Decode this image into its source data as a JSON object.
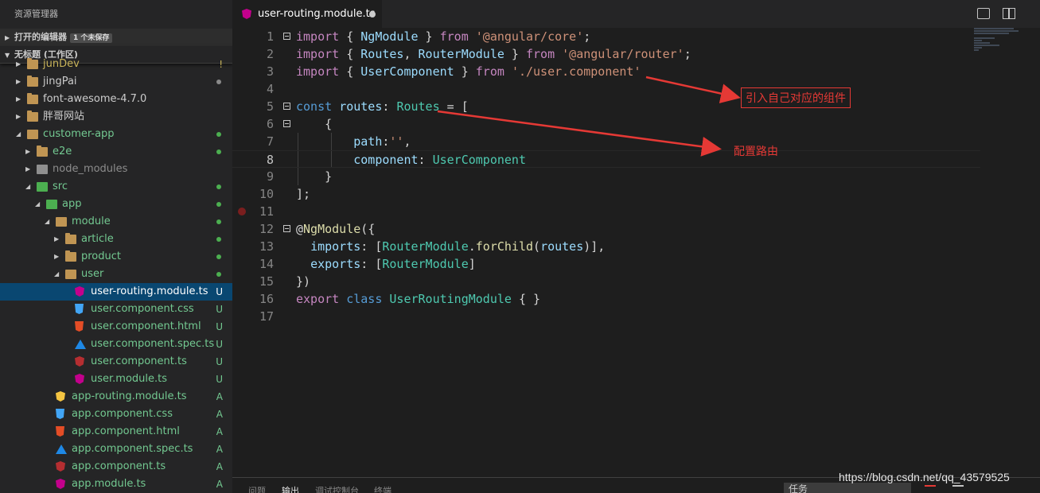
{
  "sidebar": {
    "title": "资源管理器",
    "open_editors": {
      "label": "打开的编辑器",
      "badge": "1 个未保存"
    },
    "workspace": {
      "label": "无标题 (工作区)"
    },
    "tree": [
      {
        "label": "junDev",
        "icon": "folder",
        "depth": 0,
        "color": "#c9b45a",
        "status": "!",
        "status_color": "#c9b45a"
      },
      {
        "label": "jingPai",
        "icon": "folder",
        "depth": 0,
        "color": "#cccccc",
        "dot": "#8a8a8a"
      },
      {
        "label": "font-awesome-4.7.0",
        "icon": "folder",
        "depth": 0,
        "color": "#cccccc"
      },
      {
        "label": "胖哥网站",
        "icon": "folder",
        "depth": 0,
        "color": "#cccccc"
      },
      {
        "label": "customer-app",
        "icon": "folder-open",
        "depth": 0,
        "color": "#73c991",
        "dot": "#4caf50",
        "open": true
      },
      {
        "label": "e2e",
        "icon": "folder",
        "depth": 1,
        "color": "#73c991",
        "dot": "#4caf50"
      },
      {
        "label": "node_modules",
        "icon": "folder-gray",
        "depth": 1,
        "color": "#8c8c8c"
      },
      {
        "label": "src",
        "icon": "folder-green",
        "depth": 1,
        "color": "#73c991",
        "dot": "#4caf50",
        "open": true
      },
      {
        "label": "app",
        "icon": "folder-green",
        "depth": 2,
        "color": "#73c991",
        "dot": "#4caf50",
        "open": true
      },
      {
        "label": "module",
        "icon": "folder-open",
        "depth": 3,
        "color": "#73c991",
        "dot": "#4caf50",
        "open": true
      },
      {
        "label": "article",
        "icon": "folder",
        "depth": 4,
        "color": "#73c991",
        "dot": "#4caf50"
      },
      {
        "label": "product",
        "icon": "folder",
        "depth": 4,
        "color": "#73c991",
        "dot": "#4caf50"
      },
      {
        "label": "user",
        "icon": "folder-open",
        "depth": 4,
        "color": "#73c991",
        "dot": "#4caf50",
        "open": true
      },
      {
        "label": "user-routing.module.ts",
        "icon": "ngp",
        "depth": 5,
        "color": "#ffffff",
        "status": "U",
        "status_color": "#ffffff",
        "selected": true
      },
      {
        "label": "user.component.css",
        "icon": "css",
        "depth": 5,
        "color": "#73c991",
        "status": "U",
        "status_color": "#73c991"
      },
      {
        "label": "user.component.html",
        "icon": "html",
        "depth": 5,
        "color": "#73c991",
        "status": "U",
        "status_color": "#73c991"
      },
      {
        "label": "user.component.spec.ts",
        "icon": "spec",
        "depth": 5,
        "color": "#73c991",
        "status": "U",
        "status_color": "#73c991"
      },
      {
        "label": "user.component.ts",
        "icon": "ng",
        "depth": 5,
        "color": "#73c991",
        "status": "U",
        "status_color": "#73c991"
      },
      {
        "label": "user.module.ts",
        "icon": "ngp",
        "depth": 5,
        "color": "#73c991",
        "status": "U",
        "status_color": "#73c991"
      },
      {
        "label": "app-routing.module.ts",
        "icon": "ngy",
        "depth": 3,
        "color": "#73c991",
        "status": "A",
        "status_color": "#73c991"
      },
      {
        "label": "app.component.css",
        "icon": "css",
        "depth": 3,
        "color": "#73c991",
        "status": "A",
        "status_color": "#73c991"
      },
      {
        "label": "app.component.html",
        "icon": "html",
        "depth": 3,
        "color": "#73c991",
        "status": "A",
        "status_color": "#73c991"
      },
      {
        "label": "app.component.spec.ts",
        "icon": "spec",
        "depth": 3,
        "color": "#73c991",
        "status": "A",
        "status_color": "#73c991"
      },
      {
        "label": "app.component.ts",
        "icon": "ng",
        "depth": 3,
        "color": "#73c991",
        "status": "A",
        "status_color": "#73c991"
      },
      {
        "label": "app.module.ts",
        "icon": "ngp",
        "depth": 3,
        "color": "#73c991",
        "status": "A",
        "status_color": "#73c991"
      }
    ]
  },
  "tab": {
    "name": "user-routing.module.ts",
    "icon": "angular-icon",
    "modified": true
  },
  "editor": {
    "current_line": 8,
    "breakpoint_line": 11,
    "lines": [
      {
        "n": "1",
        "fold": true,
        "tokens": [
          [
            "kc",
            "import"
          ],
          [
            "p",
            " { "
          ],
          [
            "v",
            "NgModule"
          ],
          [
            "p",
            " } "
          ],
          [
            "kc",
            "from"
          ],
          [
            "p",
            " "
          ],
          [
            "s",
            "'@angular/core'"
          ],
          [
            "p",
            ";"
          ]
        ]
      },
      {
        "n": "2",
        "tokens": [
          [
            "kc",
            "import"
          ],
          [
            "p",
            " { "
          ],
          [
            "v",
            "Routes"
          ],
          [
            "p",
            ", "
          ],
          [
            "v",
            "RouterModule"
          ],
          [
            "p",
            " } "
          ],
          [
            "kc",
            "from"
          ],
          [
            "p",
            " "
          ],
          [
            "s",
            "'@angular/router'"
          ],
          [
            "p",
            ";"
          ]
        ]
      },
      {
        "n": "3",
        "tokens": [
          [
            "kc",
            "import"
          ],
          [
            "p",
            " { "
          ],
          [
            "v",
            "UserComponent"
          ],
          [
            "p",
            " } "
          ],
          [
            "kc",
            "from"
          ],
          [
            "p",
            " "
          ],
          [
            "s",
            "'./user.component'"
          ]
        ]
      },
      {
        "n": "4",
        "tokens": []
      },
      {
        "n": "5",
        "fold": true,
        "tokens": [
          [
            "k",
            "const"
          ],
          [
            "p",
            " "
          ],
          [
            "v",
            "routes"
          ],
          [
            "p",
            ": "
          ],
          [
            "t",
            "Routes"
          ],
          [
            "p",
            " = ["
          ]
        ]
      },
      {
        "n": "6",
        "fold": true,
        "tokens": [
          [
            "p",
            "    {"
          ]
        ]
      },
      {
        "n": "7",
        "tokens": [
          [
            "p",
            "        "
          ],
          [
            "v",
            "path"
          ],
          [
            "p",
            ":"
          ],
          [
            "s",
            "''"
          ],
          [
            "p",
            ","
          ]
        ]
      },
      {
        "n": "8",
        "tokens": [
          [
            "p",
            "        "
          ],
          [
            "v",
            "component"
          ],
          [
            "p",
            ": "
          ],
          [
            "t",
            "UserComponent"
          ]
        ]
      },
      {
        "n": "9",
        "tokens": [
          [
            "p",
            "    }"
          ]
        ]
      },
      {
        "n": "10",
        "tokens": [
          [
            "p",
            "];"
          ]
        ]
      },
      {
        "n": "11",
        "tokens": []
      },
      {
        "n": "12",
        "fold": true,
        "tokens": [
          [
            "p",
            "@"
          ],
          [
            "f",
            "NgModule"
          ],
          [
            "p",
            "({"
          ]
        ]
      },
      {
        "n": "13",
        "tokens": [
          [
            "p",
            "  "
          ],
          [
            "v",
            "imports"
          ],
          [
            "p",
            ": ["
          ],
          [
            "t",
            "RouterModule"
          ],
          [
            "p",
            "."
          ],
          [
            "f",
            "forChild"
          ],
          [
            "p",
            "("
          ],
          [
            "v",
            "routes"
          ],
          [
            "p",
            ")],"
          ]
        ]
      },
      {
        "n": "14",
        "tokens": [
          [
            "p",
            "  "
          ],
          [
            "v",
            "exports"
          ],
          [
            "p",
            ": ["
          ],
          [
            "t",
            "RouterModule"
          ],
          [
            "p",
            "]"
          ]
        ]
      },
      {
        "n": "15",
        "tokens": [
          [
            "p",
            "})"
          ]
        ]
      },
      {
        "n": "16",
        "tokens": [
          [
            "kc",
            "export"
          ],
          [
            "p",
            " "
          ],
          [
            "k",
            "class"
          ],
          [
            "p",
            " "
          ],
          [
            "t",
            "UserRoutingModule"
          ],
          [
            "p",
            " { }"
          ]
        ]
      },
      {
        "n": "17",
        "tokens": []
      }
    ]
  },
  "annotations": {
    "component_note": "引入自己对应的组件",
    "route_note": "配置路由",
    "color": "#e53935"
  },
  "panel": {
    "tabs": [
      "问题",
      "输出",
      "调试控制台",
      "终端"
    ],
    "active_tab": "输出",
    "task_select": "任务"
  },
  "watermark": "https://blog.csdn.net/qq_43579525"
}
